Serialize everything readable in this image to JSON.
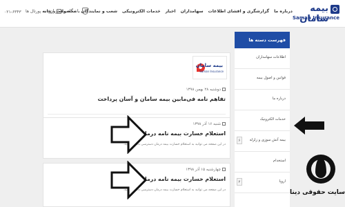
{
  "header": {
    "logo_text": "بیمه سامان",
    "logo_en": "Saman Insurance",
    "nav": [
      "خانه",
      "محصولات",
      "شعب و نمایندگان",
      "خدمات الکترونیکی",
      "اخبار",
      "سهامداران",
      "گزارشگری و افشای اطلاعات",
      "درباره ما"
    ],
    "phone": "۰۲۱-۶۳۴۳",
    "login_label": "ورود به پورتال ها",
    "club_label": "باشگاه مشتریان"
  },
  "sidebar": {
    "title": "فهرست دسته ها",
    "items": [
      {
        "label": "اطلاعات سهامداران",
        "count": ""
      },
      {
        "label": "قوانین و اصول بیمه",
        "count": ""
      },
      {
        "label": "درباره ما",
        "count": ""
      },
      {
        "label": "خدمات الکترونیک",
        "count": ""
      },
      {
        "label": "بیمه آتش سوزی و زلزله",
        "count": "۶"
      },
      {
        "label": "استخدام",
        "count": ""
      },
      {
        "label": "اروپا",
        "count": "۲"
      }
    ]
  },
  "posts": [
    {
      "date": "دوشنبه ۲۸ بهمن ۱۳۹۸",
      "title": "تفاهم نامه فی‌مابین بیمه سامان و آسان پرداخت",
      "desc": ""
    },
    {
      "date": "شنبه ۱۶ آذر ۱۳۹۸",
      "title": "استعلام خسارت بیمه نامه درمان",
      "desc": "در این صفحه می توانید به استعلام خسارت بیمه درمان دسترسی داشته باشید."
    },
    {
      "date": "چهارشنبه ۱۵ آذر ۱۳۹۸",
      "title": "استعلام خسارت بیمه نامه درمان",
      "desc": "در این صفحه می توانید به استعلام خسارت بیمه درمان دسترسی داشته باشید."
    }
  ],
  "watermark": {
    "text": "سایت حقوقی دینا"
  },
  "colors": {
    "brand_blue": "#1d3a8a",
    "sidebar_head": "#1f4da6",
    "accent_red": "#e7322c"
  }
}
